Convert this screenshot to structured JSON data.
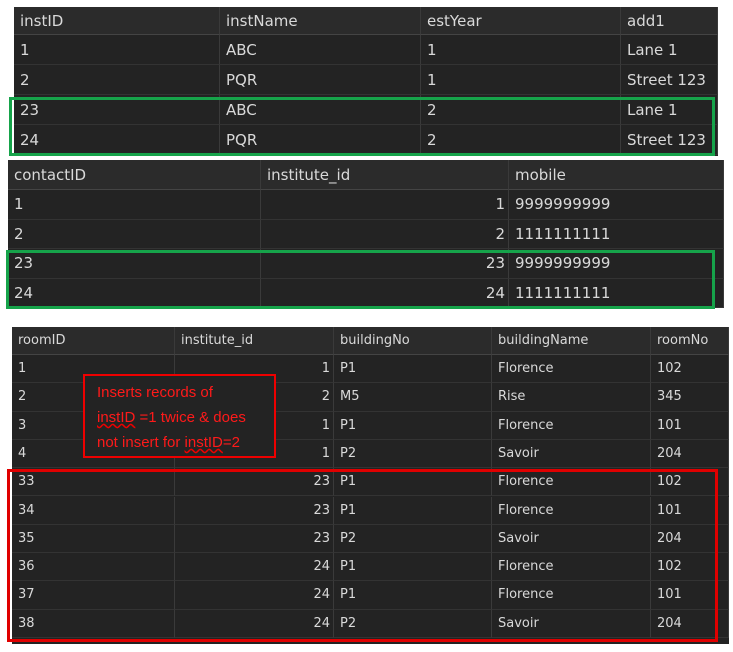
{
  "institutes": {
    "columns": [
      "instID",
      "instName",
      "estYear",
      "add1"
    ],
    "rows": [
      [
        "1",
        "ABC",
        "1",
        "Lane 1"
      ],
      [
        "2",
        "PQR",
        "1",
        "Street 123"
      ],
      [
        "23",
        "ABC",
        "2",
        "Lane 1"
      ],
      [
        "24",
        "PQR",
        "2",
        "Street 123"
      ]
    ]
  },
  "contacts": {
    "columns": [
      "contactID",
      "institute_id",
      "mobile"
    ],
    "rows": [
      [
        "1",
        "1",
        "9999999999"
      ],
      [
        "2",
        "2",
        "1111111111"
      ],
      [
        "23",
        "23",
        "9999999999"
      ],
      [
        "24",
        "24",
        "1111111111"
      ]
    ]
  },
  "rooms": {
    "columns": [
      "roomID",
      "institute_id",
      "buildingNo",
      "buildingName",
      "roomNo"
    ],
    "rows": [
      [
        "1",
        "1",
        "P1",
        "Florence",
        "102"
      ],
      [
        "2",
        "2",
        "M5",
        "Rise",
        "345"
      ],
      [
        "3",
        "1",
        "P1",
        "Florence",
        "101"
      ],
      [
        "4",
        "1",
        "P2",
        "Savoir",
        "204"
      ],
      [
        "33",
        "23",
        "P1",
        "Florence",
        "102"
      ],
      [
        "34",
        "23",
        "P1",
        "Florence",
        "101"
      ],
      [
        "35",
        "23",
        "P2",
        "Savoir",
        "204"
      ],
      [
        "36",
        "24",
        "P1",
        "Florence",
        "102"
      ],
      [
        "37",
        "24",
        "P1",
        "Florence",
        "101"
      ],
      [
        "38",
        "24",
        "P2",
        "Savoir",
        "204"
      ]
    ]
  },
  "annotation": {
    "line1": "Inserts records of",
    "line2_underlined": "instID",
    "line2_rest": " =1 twice & does",
    "line3_start": "not insert for ",
    "line3_underlined": "instID",
    "line3_end": "=2"
  },
  "colors": {
    "green_highlight": "#16a34a",
    "red_highlight": "#e00000",
    "grid_bg": "#232323"
  }
}
